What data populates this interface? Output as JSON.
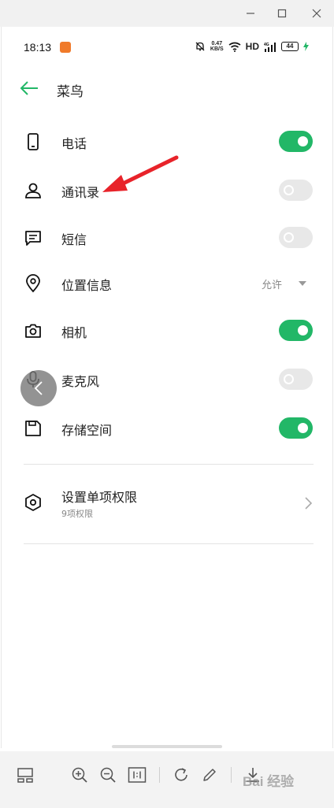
{
  "window": {
    "minimize_icon": "minimize-icon",
    "maximize_icon": "maximize-icon",
    "close_icon": "close-icon"
  },
  "status_bar": {
    "time": "18:13",
    "net_speed_value": "0.47",
    "net_speed_unit": "KB/S",
    "network_label": "HD",
    "battery": "44",
    "signal_label": "4G"
  },
  "header": {
    "title": "菜鸟"
  },
  "permissions": [
    {
      "label": "电话",
      "icon": "phone-icon",
      "state": "on"
    },
    {
      "label": "通讯录",
      "icon": "contacts-icon",
      "state": "off"
    },
    {
      "label": "短信",
      "icon": "message-icon",
      "state": "off"
    },
    {
      "label": "位置信息",
      "icon": "location-icon",
      "value": "允许"
    },
    {
      "label": "相机",
      "icon": "camera-icon",
      "state": "on"
    },
    {
      "label": "麦克风",
      "icon": "microphone-icon",
      "state": "off"
    },
    {
      "label": "存储空间",
      "icon": "storage-icon",
      "state": "on"
    }
  ],
  "single_permission": {
    "title": "设置单项权限",
    "subtitle": "9项权限"
  },
  "toolbar": {
    "watermark": "Bai 经验"
  },
  "colors": {
    "accent_green": "#22b767",
    "annotation_red": "#e8232a",
    "toggle_off": "#e8e8e8"
  }
}
